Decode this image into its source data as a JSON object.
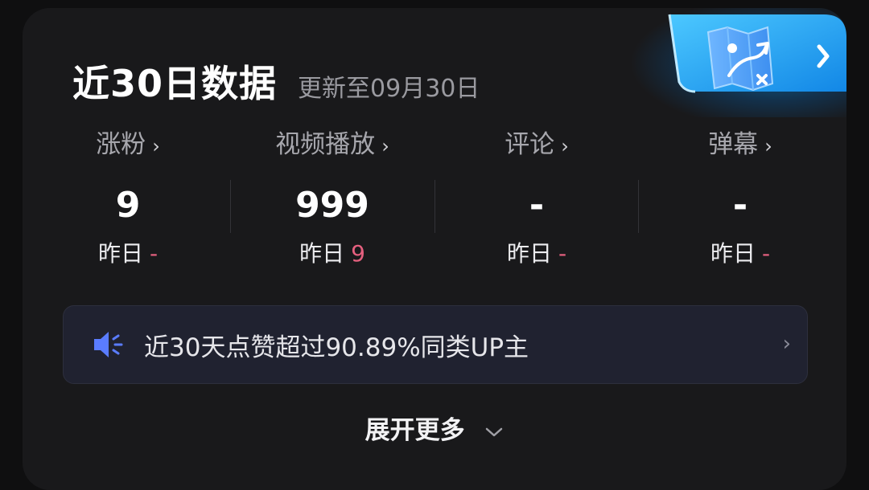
{
  "header": {
    "title": "近30日数据",
    "subtitle": "更新至09月30日"
  },
  "stats": [
    {
      "label": "涨粉",
      "value": "9",
      "sub_label": "昨日",
      "sub_delta": "-"
    },
    {
      "label": "视频播放",
      "value": "999",
      "sub_label": "昨日",
      "sub_delta": "9"
    },
    {
      "label": "评论",
      "value": "-",
      "sub_label": "昨日",
      "sub_delta": "-"
    },
    {
      "label": "弹幕",
      "value": "-",
      "sub_label": "昨日",
      "sub_delta": "-"
    }
  ],
  "notice": {
    "text": "近30天点赞超过90.89%同类UP主",
    "icon": "speaker-icon"
  },
  "expand": {
    "label": "展开更多",
    "icon": "chevron-down-icon"
  },
  "badge": {
    "icon": "strategy-map-icon",
    "arrow_icon": "chevron-right-icon"
  },
  "colors": {
    "accent_pink": "#e5607f",
    "notice_blue": "#5a7cff",
    "badge_blue": "#0a9bff"
  }
}
